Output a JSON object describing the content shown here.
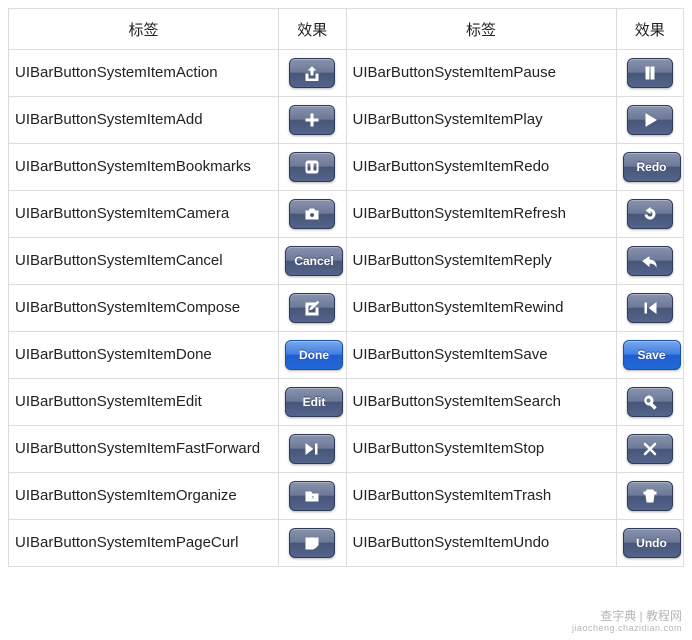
{
  "headers": {
    "label": "标签",
    "effect": "效果"
  },
  "rows": [
    {
      "left_label": "UIBarButtonSystemItemAction",
      "left_btn": {
        "type": "icon",
        "name": "action-icon"
      },
      "right_label": "UIBarButtonSystemItemPause",
      "right_btn": {
        "type": "icon",
        "name": "pause-icon"
      }
    },
    {
      "left_label": "UIBarButtonSystemItemAdd",
      "left_btn": {
        "type": "icon",
        "name": "plus-icon"
      },
      "right_label": "UIBarButtonSystemItemPlay",
      "right_btn": {
        "type": "icon",
        "name": "play-icon"
      }
    },
    {
      "left_label": "UIBarButtonSystemItemBookmarks",
      "left_btn": {
        "type": "icon",
        "name": "bookmarks-icon"
      },
      "right_label": "UIBarButtonSystemItemRedo",
      "right_btn": {
        "type": "text",
        "text": "Redo"
      }
    },
    {
      "left_label": "UIBarButtonSystemItemCamera",
      "left_btn": {
        "type": "icon",
        "name": "camera-icon"
      },
      "right_label": "UIBarButtonSystemItemRefresh",
      "right_btn": {
        "type": "icon",
        "name": "refresh-icon"
      }
    },
    {
      "left_label": "UIBarButtonSystemItemCancel",
      "left_btn": {
        "type": "text",
        "text": "Cancel"
      },
      "right_label": "UIBarButtonSystemItemReply",
      "right_btn": {
        "type": "icon",
        "name": "reply-icon"
      }
    },
    {
      "left_label": "UIBarButtonSystemItemCompose",
      "left_btn": {
        "type": "icon",
        "name": "compose-icon"
      },
      "right_label": "UIBarButtonSystemItemRewind",
      "right_btn": {
        "type": "icon",
        "name": "rewind-icon"
      }
    },
    {
      "left_label": "UIBarButtonSystemItemDone",
      "left_btn": {
        "type": "text",
        "text": "Done",
        "style": "blue"
      },
      "right_label": "UIBarButtonSystemItemSave",
      "right_btn": {
        "type": "text",
        "text": "Save",
        "style": "blue"
      }
    },
    {
      "left_label": "UIBarButtonSystemItemEdit",
      "left_btn": {
        "type": "text",
        "text": "Edit"
      },
      "right_label": "UIBarButtonSystemItemSearch",
      "right_btn": {
        "type": "icon",
        "name": "search-icon"
      }
    },
    {
      "left_label": "UIBarButtonSystemItemFastForward",
      "left_btn": {
        "type": "icon",
        "name": "fastforward-icon"
      },
      "right_label": "UIBarButtonSystemItemStop",
      "right_btn": {
        "type": "icon",
        "name": "stop-icon"
      }
    },
    {
      "left_label": "UIBarButtonSystemItemOrganize",
      "left_btn": {
        "type": "icon",
        "name": "organize-icon"
      },
      "right_label": "UIBarButtonSystemItemTrash",
      "right_btn": {
        "type": "icon",
        "name": "trash-icon"
      }
    },
    {
      "left_label": "UIBarButtonSystemItemPageCurl",
      "left_btn": {
        "type": "icon",
        "name": "pagecurl-icon"
      },
      "right_label": "UIBarButtonSystemItemUndo",
      "right_btn": {
        "type": "text",
        "text": "Undo"
      }
    }
  ],
  "watermark": {
    "line1": "查字典 | 教程网",
    "line2": "jiaocheng.chazidian.com"
  }
}
